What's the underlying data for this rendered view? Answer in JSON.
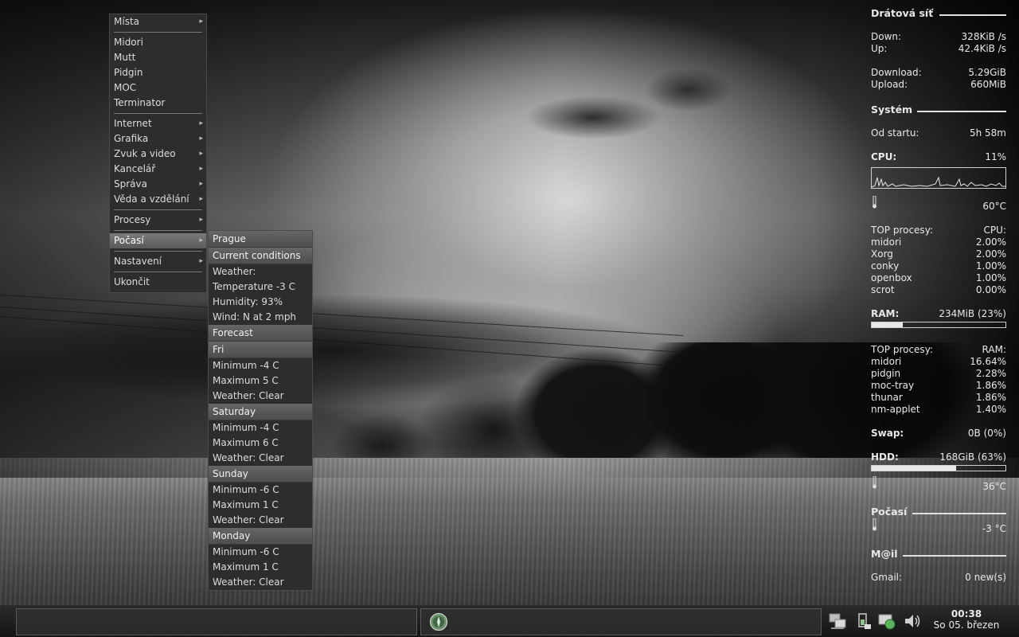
{
  "menu": {
    "items": [
      {
        "label": "Místa",
        "submenu": true
      },
      {
        "sep": true
      },
      {
        "label": "Midori"
      },
      {
        "label": "Mutt"
      },
      {
        "label": "Pidgin"
      },
      {
        "label": "MOC"
      },
      {
        "label": "Terminator"
      },
      {
        "sep": true
      },
      {
        "label": "Internet",
        "submenu": true
      },
      {
        "label": "Grafika",
        "submenu": true
      },
      {
        "label": "Zvuk a video",
        "submenu": true
      },
      {
        "label": "Kancelář",
        "submenu": true
      },
      {
        "label": "Správa",
        "submenu": true
      },
      {
        "label": "Věda a vzdělání",
        "submenu": true
      },
      {
        "sep": true
      },
      {
        "label": "Procesy",
        "submenu": true
      },
      {
        "sep": true
      },
      {
        "label": "Počasí",
        "submenu": true,
        "active": true
      },
      {
        "sep": true
      },
      {
        "label": "Nastavení",
        "submenu": true
      },
      {
        "sep": true
      },
      {
        "label": "Ukončit"
      }
    ]
  },
  "weather": {
    "city": "Prague",
    "current_title": "Current conditions",
    "current": [
      "Weather:",
      "Temperature -3 C",
      "Humidity: 93%",
      "Wind: N at 2 mph"
    ],
    "forecast_title": "Forecast",
    "days": [
      {
        "name": "Fri",
        "lines": [
          "Minimum -4 C",
          "Maximum 5 C",
          "Weather: Clear"
        ]
      },
      {
        "name": "Saturday",
        "lines": [
          "Minimum -4 C",
          "Maximum 6 C",
          "Weather: Clear"
        ]
      },
      {
        "name": "Sunday",
        "lines": [
          "Minimum -6 C",
          "Maximum 1 C",
          "Weather: Clear"
        ]
      },
      {
        "name": "Monday",
        "lines": [
          "Minimum -6 C",
          "Maximum 1 C",
          "Weather: Clear"
        ]
      }
    ]
  },
  "conky": {
    "net_title": "Drátová síť",
    "down_label": "Down:",
    "down_value": "328KiB /s",
    "up_label": "Up:",
    "up_value": "42.4KiB /s",
    "download_label": "Download:",
    "download_value": "5.29GiB",
    "upload_label": "Upload:",
    "upload_value": "660MiB",
    "system_title": "Systém",
    "uptime_label": "Od startu:",
    "uptime_value": "5h 58m",
    "cpu_label": "CPU:",
    "cpu_value": "11%",
    "cpu_temp": "60°C",
    "top_cpu_header_left": "TOP procesy:",
    "top_cpu_header_right": "CPU:",
    "top_cpu": [
      {
        "name": "midori",
        "value": "2.00%"
      },
      {
        "name": "Xorg",
        "value": "2.00%"
      },
      {
        "name": "conky",
        "value": "1.00%"
      },
      {
        "name": "openbox",
        "value": "1.00%"
      },
      {
        "name": "scrot",
        "value": "0.00%"
      }
    ],
    "ram_label": "RAM:",
    "ram_value": "234MiB (23%)",
    "ram_fraction": 0.23,
    "top_ram_header_left": "TOP procesy:",
    "top_ram_header_right": "RAM:",
    "top_ram": [
      {
        "name": "midori",
        "value": "16.64%"
      },
      {
        "name": "pidgin",
        "value": "2.28%"
      },
      {
        "name": "moc-tray",
        "value": "1.86%"
      },
      {
        "name": "thunar",
        "value": "1.86%"
      },
      {
        "name": "nm-applet",
        "value": "1.40%"
      }
    ],
    "swap_label": "Swap:",
    "swap_value": "0B   (0%)",
    "hdd_label": "HDD:",
    "hdd_value": "168GiB (63%)",
    "hdd_fraction": 0.63,
    "hdd_temp": "36°C",
    "weather_title": "Počasí",
    "weather_temp": "-3 °C",
    "mail_title": "M@il",
    "gmail_label": "Gmail:",
    "gmail_value": "0 new(s)"
  },
  "taskbar": {
    "time": "00:38",
    "date": "So 05. březen",
    "tray_icons": [
      "network-icon",
      "battery-icon",
      "network-manager-icon",
      "volume-icon"
    ],
    "launcher_icon": "compass-icon"
  }
}
